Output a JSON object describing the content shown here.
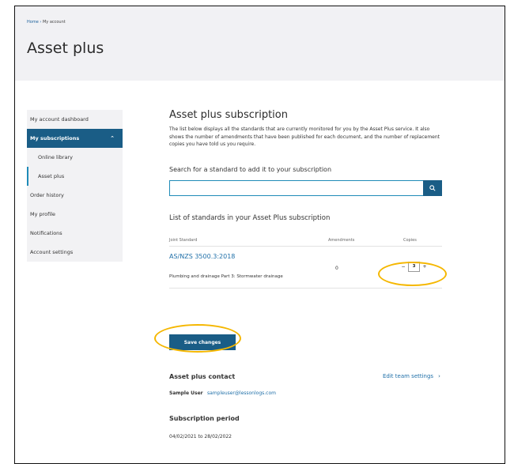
{
  "breadcrumb": {
    "home": "Home",
    "separator": "›",
    "current": "My account"
  },
  "page": {
    "title": "Asset plus"
  },
  "sidebar": {
    "items": [
      {
        "label": "My account dashboard"
      },
      {
        "label": "My subscriptions",
        "chevron": "⌃"
      },
      {
        "label": "Online library"
      },
      {
        "label": "Asset plus"
      },
      {
        "label": "Order history"
      },
      {
        "label": "My profile"
      },
      {
        "label": "Notifications"
      },
      {
        "label": "Account settings"
      }
    ]
  },
  "main": {
    "title": "Asset plus subscription",
    "description": "The list below displays all the standards that are currently monitored for you by the Asset Plus service. It also shows the number of amendments that have been published for each document, and the number of replacement copies you have told us you require.",
    "search_label": "Search for a standard to add it to your subscription",
    "search_value": "",
    "search_placeholder": "",
    "list_title": "List of standards in your Asset Plus subscription",
    "columns": {
      "standard": "Joint Standard",
      "amendments": "Amendments",
      "copies": "Copies"
    },
    "rows": [
      {
        "code": "AS/NZS 3500.3:2018",
        "name": "Plumbing and drainage Part 3: Stormwater drainage",
        "amendments": "0",
        "copies": "3"
      }
    ],
    "stepper": {
      "minus": "−",
      "plus": "+"
    },
    "save_label": "Save changes"
  },
  "contact": {
    "title": "Asset plus contact",
    "edit_label": "Edit team settings",
    "edit_arrow": "›",
    "name": "Sample User",
    "email": "sampleuser@lessonlogs.com"
  },
  "subscription": {
    "title": "Subscription period",
    "period": "04/02/2021 to 28/02/2022"
  },
  "colors": {
    "accent": "#1a5d86",
    "highlight": "#f5b700",
    "link": "#1f6fa8"
  }
}
